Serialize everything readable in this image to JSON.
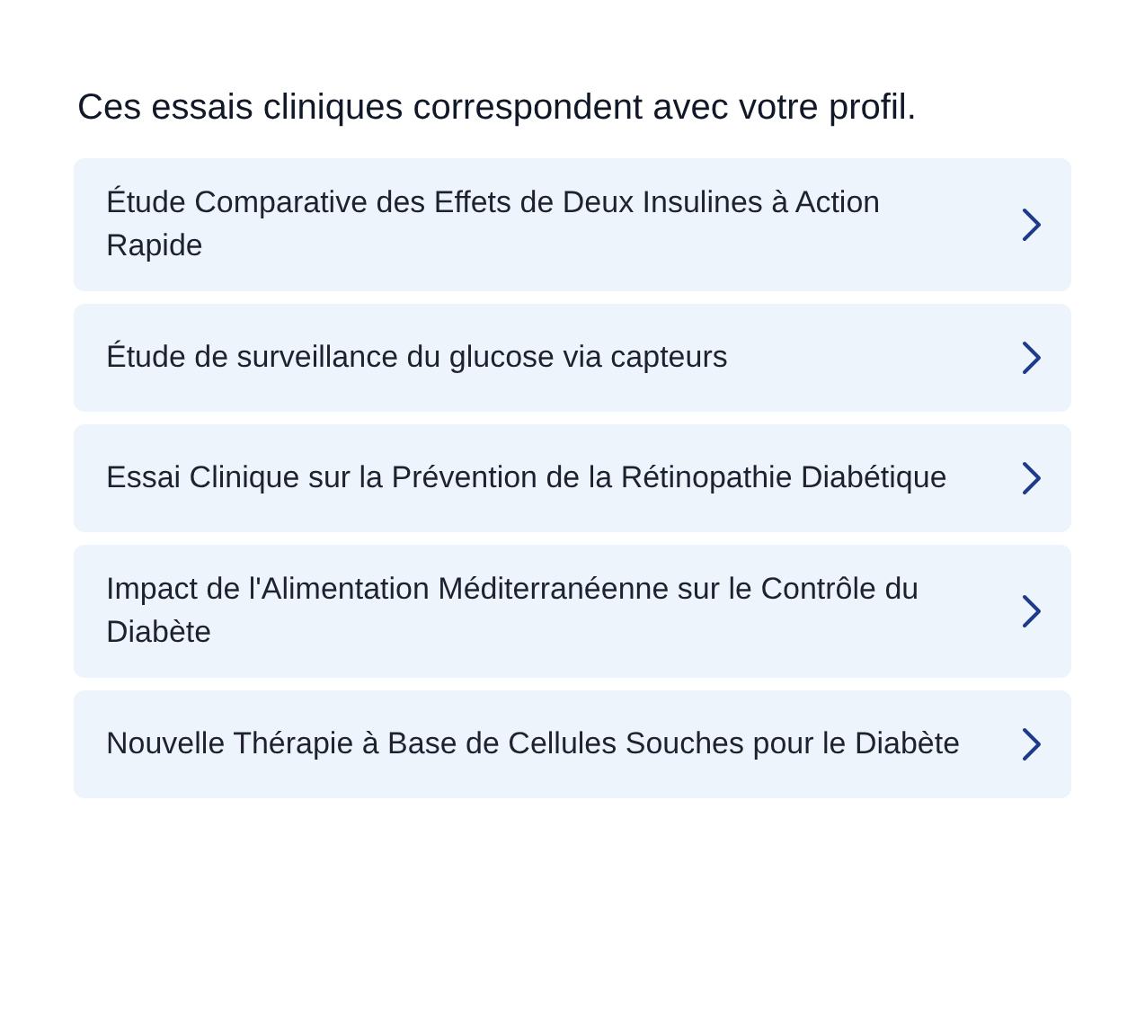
{
  "heading": "Ces essais cliniques correspondent avec votre profil.",
  "trials": [
    {
      "title": "Étude Comparative des Effets de Deux Insulines à Action Rapide"
    },
    {
      "title": "Étude de surveillance du glucose via capteurs"
    },
    {
      "title": "Essai Clinique sur la Prévention de la Rétinopathie Diabétique"
    },
    {
      "title": "Impact de l'Alimentation Méditerranéenne sur le Contrôle du Diabète"
    },
    {
      "title": "Nouvelle Thérapie à Base de Cellules Souches pour le Diabète"
    }
  ]
}
